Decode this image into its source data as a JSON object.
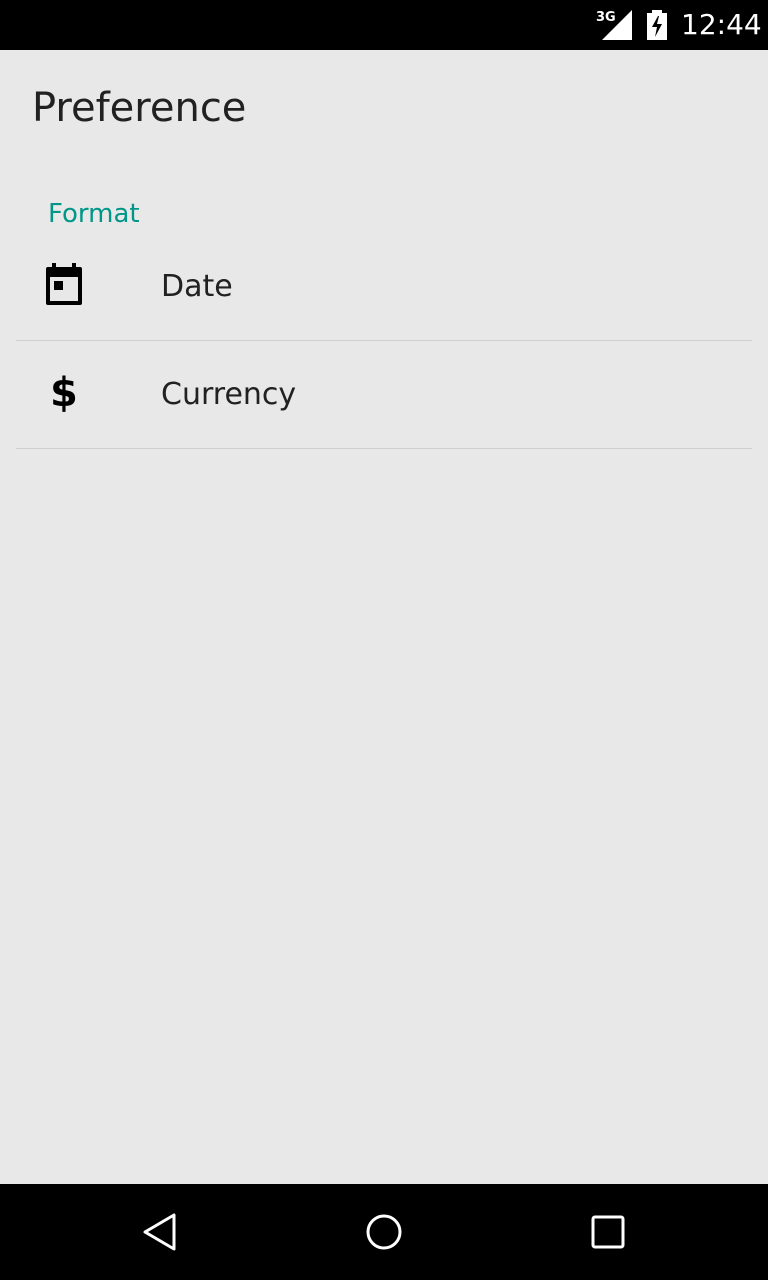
{
  "status_bar": {
    "network": "3G",
    "time": "12:44",
    "icons": [
      "signal-icon",
      "battery-charging-icon"
    ]
  },
  "screen": {
    "title": "Preference"
  },
  "category": {
    "label": "Format",
    "color": "#009688"
  },
  "preferences": [
    {
      "label": "Date",
      "icon": "calendar-icon"
    },
    {
      "label": "Currency",
      "icon": "dollar-icon",
      "glyph": "$"
    }
  ],
  "nav_bar": {
    "icons": [
      "back-icon",
      "home-icon",
      "recents-icon"
    ]
  }
}
